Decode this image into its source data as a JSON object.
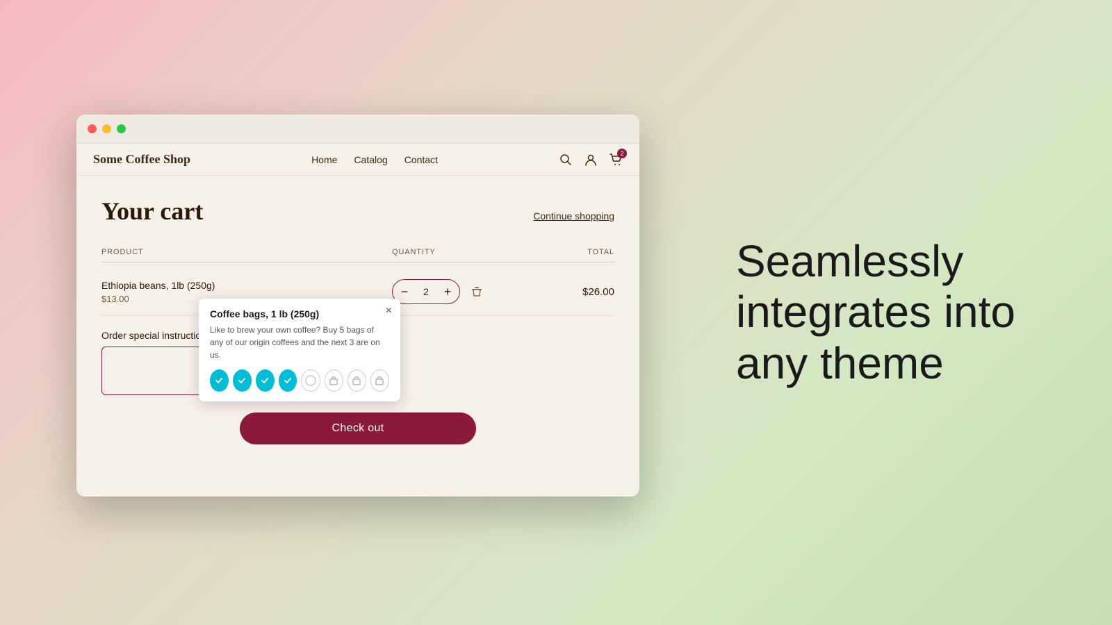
{
  "background": {
    "gradient": "linear-gradient(135deg, #f4b8c1 0%, #e8d5c4 30%, #d4e8c4 70%, #c4ddb4 100%)"
  },
  "mac_window": {
    "buttons": [
      "close",
      "minimize",
      "maximize"
    ]
  },
  "nav": {
    "brand": "Some Coffee Shop",
    "links": [
      "Home",
      "Catalog",
      "Contact"
    ],
    "cart_count": "2"
  },
  "cart": {
    "title": "Your cart",
    "continue_shopping": "Continue shopping",
    "table_headers": {
      "product": "PRODUCT",
      "quantity": "QUANTITY",
      "total": "TOTAL"
    },
    "product": {
      "name": "Ethiopia beans, 1lb (250g)",
      "price": "$13.00",
      "quantity": "2",
      "total": "$26.00"
    },
    "order_instructions": {
      "label": "Order special instructions",
      "placeholder": ""
    },
    "checkout_button": "Check out"
  },
  "popup": {
    "title": "Coffee bags, 1 lb (250g)",
    "description": "Like to brew your own coffee? Buy 5 bags of any of our origin coffees and the next 3 are on us.",
    "close_label": "×",
    "icons": [
      {
        "type": "checked-cyan",
        "label": "checked-1"
      },
      {
        "type": "checked-cyan",
        "label": "checked-2"
      },
      {
        "type": "checked-cyan",
        "label": "checked-3"
      },
      {
        "type": "checked-cyan",
        "label": "checked-4"
      },
      {
        "type": "empty-white",
        "label": "empty-1"
      },
      {
        "type": "bag-gray",
        "label": "bag-1"
      },
      {
        "type": "bag-gray",
        "label": "bag-2"
      },
      {
        "type": "bag-gray",
        "label": "bag-3"
      }
    ]
  },
  "tagline": {
    "line1": "Seamlessly",
    "line2": "integrates into",
    "line3": "any theme"
  }
}
